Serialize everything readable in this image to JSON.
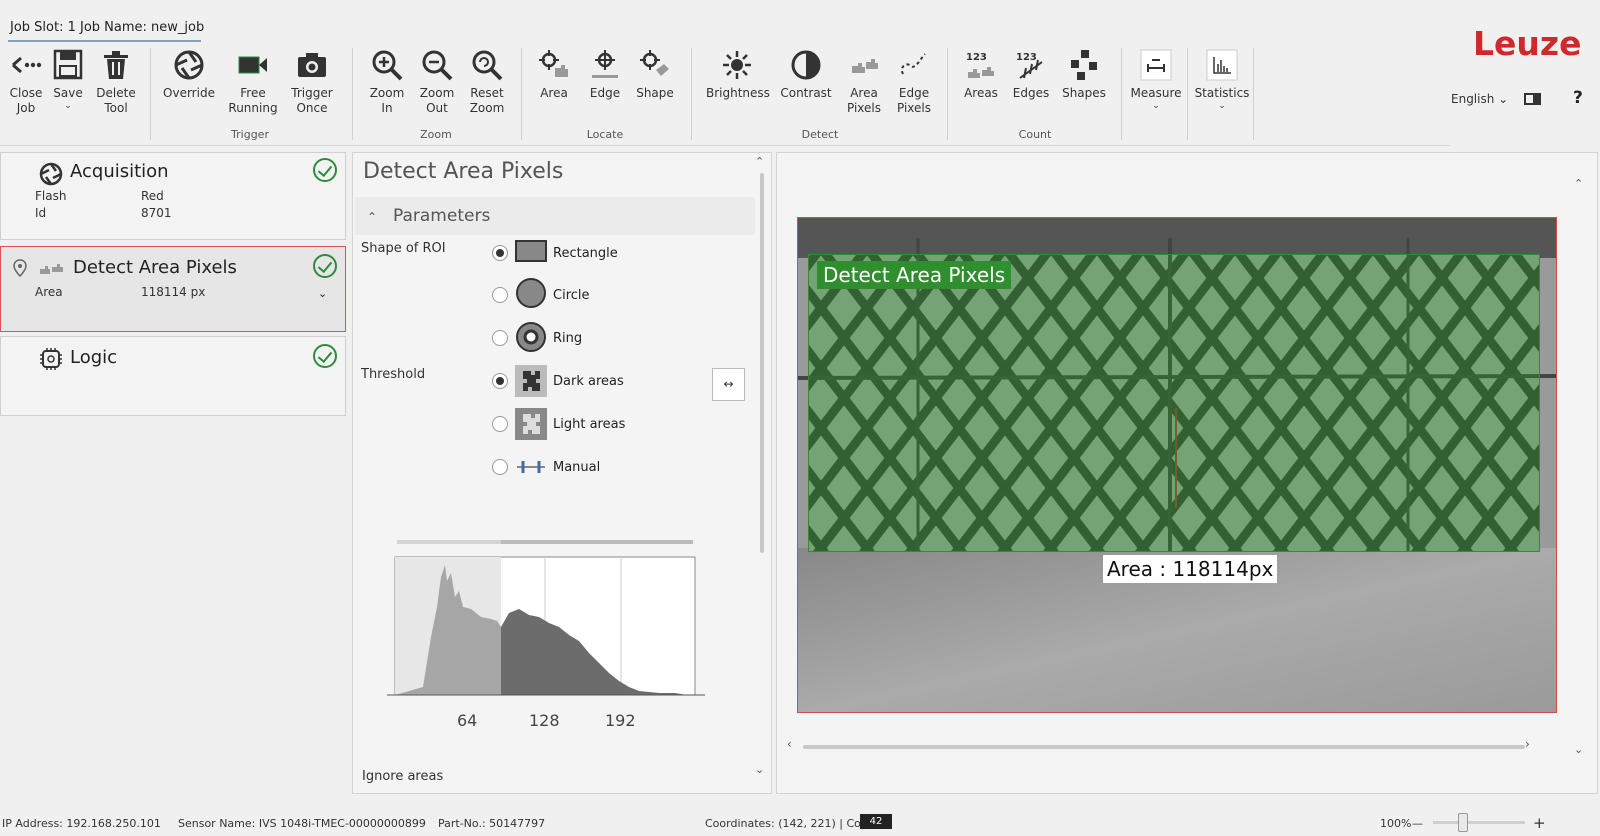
{
  "header": {
    "job_title": "Job Slot: 1 Job Name: new_job",
    "logo": "Leuze",
    "language": "English",
    "help": "?"
  },
  "ribbon": {
    "buttons": [
      {
        "label": "Close\nJob",
        "icon": "close-job-icon"
      },
      {
        "label": "Save",
        "icon": "save-icon",
        "caret": "⌄"
      },
      {
        "label": "Delete\nTool",
        "icon": "delete-icon"
      },
      {
        "label": "Override",
        "icon": "override-icon"
      },
      {
        "label": "Free\nRunning",
        "icon": "video-icon"
      },
      {
        "label": "Trigger\nOnce",
        "icon": "camera-icon"
      },
      {
        "label": "Zoom\nIn",
        "icon": "zoom-in-icon"
      },
      {
        "label": "Zoom\nOut",
        "icon": "zoom-out-icon"
      },
      {
        "label": "Reset\nZoom",
        "icon": "zoom-reset-icon"
      },
      {
        "label": "Area",
        "icon": "locate-area-icon"
      },
      {
        "label": "Edge",
        "icon": "locate-edge-icon"
      },
      {
        "label": "Shape",
        "icon": "locate-shape-icon"
      },
      {
        "label": "Brightness",
        "icon": "brightness-icon"
      },
      {
        "label": "Contrast",
        "icon": "contrast-icon"
      },
      {
        "label": "Area\nPixels",
        "icon": "area-pixels-icon"
      },
      {
        "label": "Edge\nPixels",
        "icon": "edge-pixels-icon"
      },
      {
        "label": "Areas",
        "icon": "count-areas-icon"
      },
      {
        "label": "Edges",
        "icon": "count-edges-icon"
      },
      {
        "label": "Shapes",
        "icon": "count-shapes-icon"
      },
      {
        "label": "Measure",
        "icon": "measure-icon",
        "caret": "⌄"
      },
      {
        "label": "Statistics",
        "icon": "statistics-icon",
        "caret": "⌄"
      }
    ],
    "groups": {
      "trigger": "Trigger",
      "zoom": "Zoom",
      "locate": "Locate",
      "detect": "Detect",
      "count": "Count"
    }
  },
  "steps": {
    "acquisition": {
      "title": "Acquisition",
      "k1": "Flash",
      "v1": "Red",
      "k2": "Id",
      "v2": "8701"
    },
    "detect": {
      "title": "Detect Area Pixels",
      "k1": "Area",
      "v1": "118114 px"
    },
    "logic": {
      "title": "Logic"
    }
  },
  "params": {
    "title": "Detect Area Pixels",
    "section": "Parameters",
    "shape_label": "Shape of ROI",
    "shape_options": [
      "Rectangle",
      "Circle",
      "Ring"
    ],
    "shape_selected": "Rectangle",
    "threshold_label": "Threshold",
    "threshold_options": [
      "Dark areas",
      "Light areas",
      "Manual"
    ],
    "threshold_selected": "Dark areas",
    "swap_symbol": "↔",
    "histogram_ticks": [
      "64",
      "128",
      "192"
    ],
    "ignore_label": "Ignore areas"
  },
  "viewer": {
    "roi_label": "Detect Area Pixels",
    "result": "Area : 118114px"
  },
  "status": {
    "ip": "IP Address:   192.168.250.101",
    "sensor": "Sensor Name:   IVS 1048i-TMEC-00000000899",
    "part": "Part-No.:   50147797",
    "coords": "Coordinates: (142, 221) | Color:",
    "color_value": "42",
    "zoom": "100%",
    "zoom_minus": "—",
    "zoom_plus": "+"
  },
  "colors": {
    "accent": "#2e8b3c",
    "brand": "#d0292b",
    "roi": "#2f8f2f",
    "active_border": "#e05252"
  }
}
